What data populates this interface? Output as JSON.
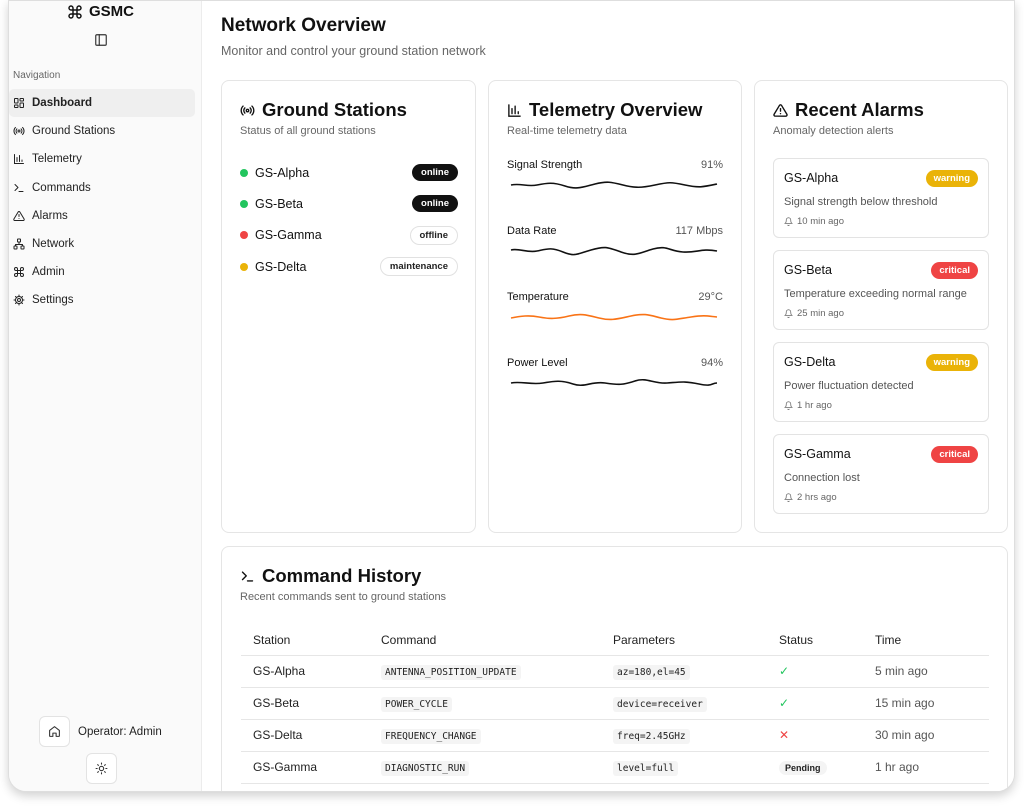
{
  "app": {
    "name": "GSMC"
  },
  "sidebar": {
    "nav_label": "Navigation",
    "items": [
      {
        "label": "Dashboard",
        "icon": "dashboard-icon",
        "active": true
      },
      {
        "label": "Ground Stations",
        "icon": "radio-icon"
      },
      {
        "label": "Telemetry",
        "icon": "bar-chart-icon"
      },
      {
        "label": "Commands",
        "icon": "terminal-icon"
      },
      {
        "label": "Alarms",
        "icon": "alert-triangle-icon"
      },
      {
        "label": "Network",
        "icon": "network-icon"
      },
      {
        "label": "Admin",
        "icon": "command-icon"
      },
      {
        "label": "Settings",
        "icon": "gear-icon"
      }
    ],
    "operator": "Operator: Admin"
  },
  "header": {
    "title": "Network Overview",
    "subtitle": "Monitor and control your ground station network"
  },
  "stations_card": {
    "title": "Ground Stations",
    "subtitle": "Status of all ground stations",
    "stations": [
      {
        "name": "GS-Alpha",
        "status": "online",
        "color": "#22c55e"
      },
      {
        "name": "GS-Beta",
        "status": "online",
        "color": "#22c55e"
      },
      {
        "name": "GS-Gamma",
        "status": "offline",
        "color": "#ef4444"
      },
      {
        "name": "GS-Delta",
        "status": "maintenance",
        "color": "#eab308"
      }
    ]
  },
  "telemetry_card": {
    "title": "Telemetry Overview",
    "subtitle": "Real-time telemetry data",
    "metrics": [
      {
        "label": "Signal Strength",
        "value": "91%",
        "color": "#111111"
      },
      {
        "label": "Data Rate",
        "value": "117 Mbps",
        "color": "#111111"
      },
      {
        "label": "Temperature",
        "value": "29°C",
        "color": "#f97316"
      },
      {
        "label": "Power Level",
        "value": "94%",
        "color": "#111111"
      }
    ]
  },
  "alarms_card": {
    "title": "Recent Alarms",
    "subtitle": "Anomaly detection alerts",
    "alarms": [
      {
        "station": "GS-Alpha",
        "severity": "warning",
        "message": "Signal strength below threshold",
        "time": "10 min ago"
      },
      {
        "station": "GS-Beta",
        "severity": "critical",
        "message": "Temperature exceeding normal range",
        "time": "25 min ago"
      },
      {
        "station": "GS-Delta",
        "severity": "warning",
        "message": "Power fluctuation detected",
        "time": "1 hr ago"
      },
      {
        "station": "GS-Gamma",
        "severity": "critical",
        "message": "Connection lost",
        "time": "2 hrs ago"
      }
    ]
  },
  "command_card": {
    "title": "Command History",
    "subtitle": "Recent commands sent to ground stations",
    "columns": [
      "Station",
      "Command",
      "Parameters",
      "Status",
      "Time"
    ],
    "rows": [
      {
        "station": "GS-Alpha",
        "command": "ANTENNA_POSITION_UPDATE",
        "params": "az=180,el=45",
        "status": "success",
        "time": "5 min ago"
      },
      {
        "station": "GS-Beta",
        "command": "POWER_CYCLE",
        "params": "device=receiver",
        "status": "success",
        "time": "15 min ago"
      },
      {
        "station": "GS-Delta",
        "command": "FREQUENCY_CHANGE",
        "params": "freq=2.45GHz",
        "status": "failed",
        "time": "30 min ago"
      },
      {
        "station": "GS-Gamma",
        "command": "DIAGNOSTIC_RUN",
        "params": "level=full",
        "status": "Pending",
        "time": "1 hr ago"
      }
    ]
  }
}
